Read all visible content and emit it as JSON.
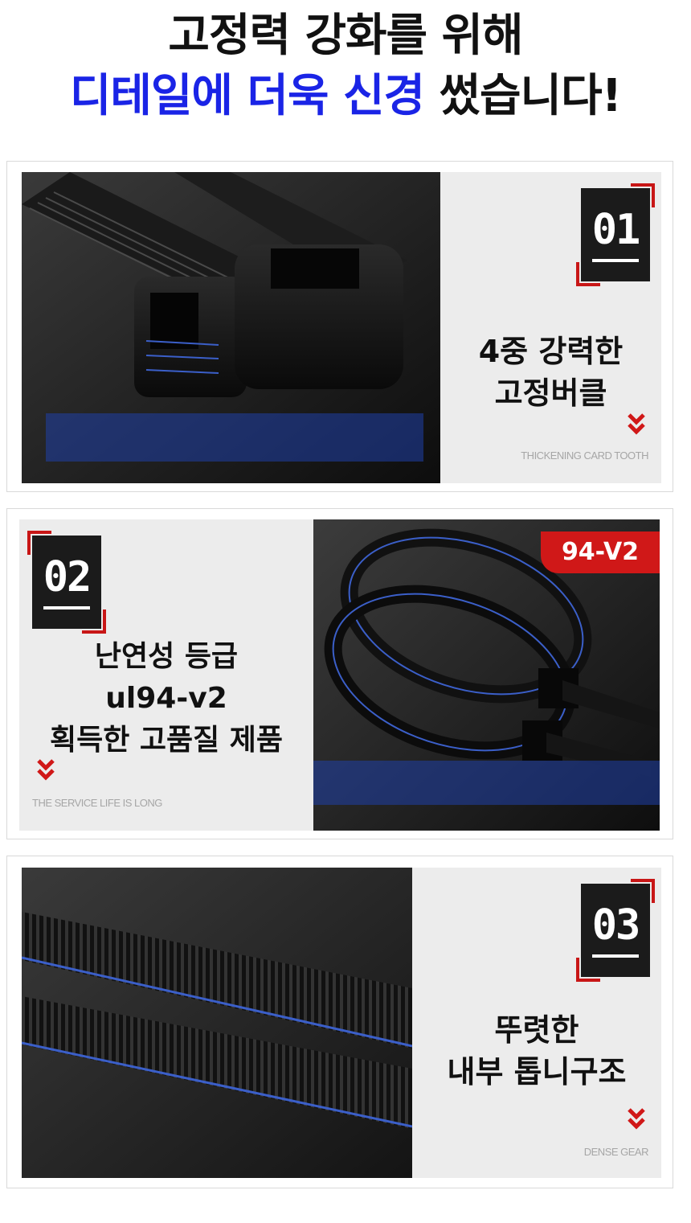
{
  "header": {
    "line1": "고정력 강화를 위해",
    "line2_blue": "디테일에 더욱 신경",
    "line2_dark": " 썼습니다!"
  },
  "features": [
    {
      "number": "01",
      "title_line1": "4중 강력한",
      "title_line2": "고정버클",
      "caption": "THICKENING CARD TOOTH"
    },
    {
      "number": "02",
      "title_line1": "난연성 등급",
      "title_line2": "ul94-v2",
      "title_line3": "획득한 고품질 제품",
      "caption": "THE SERVICE LIFE IS LONG",
      "tag": "94-V2"
    },
    {
      "number": "03",
      "title_line1": "뚜렷한",
      "title_line2": "내부 톱니구조",
      "caption": "DENSE GEAR"
    }
  ],
  "colors": {
    "accent_blue": "#1a24e6",
    "accent_red": "#d01818",
    "badge_bg": "#1b1b1b"
  },
  "icons": [
    "chevron-double-down-icon"
  ]
}
